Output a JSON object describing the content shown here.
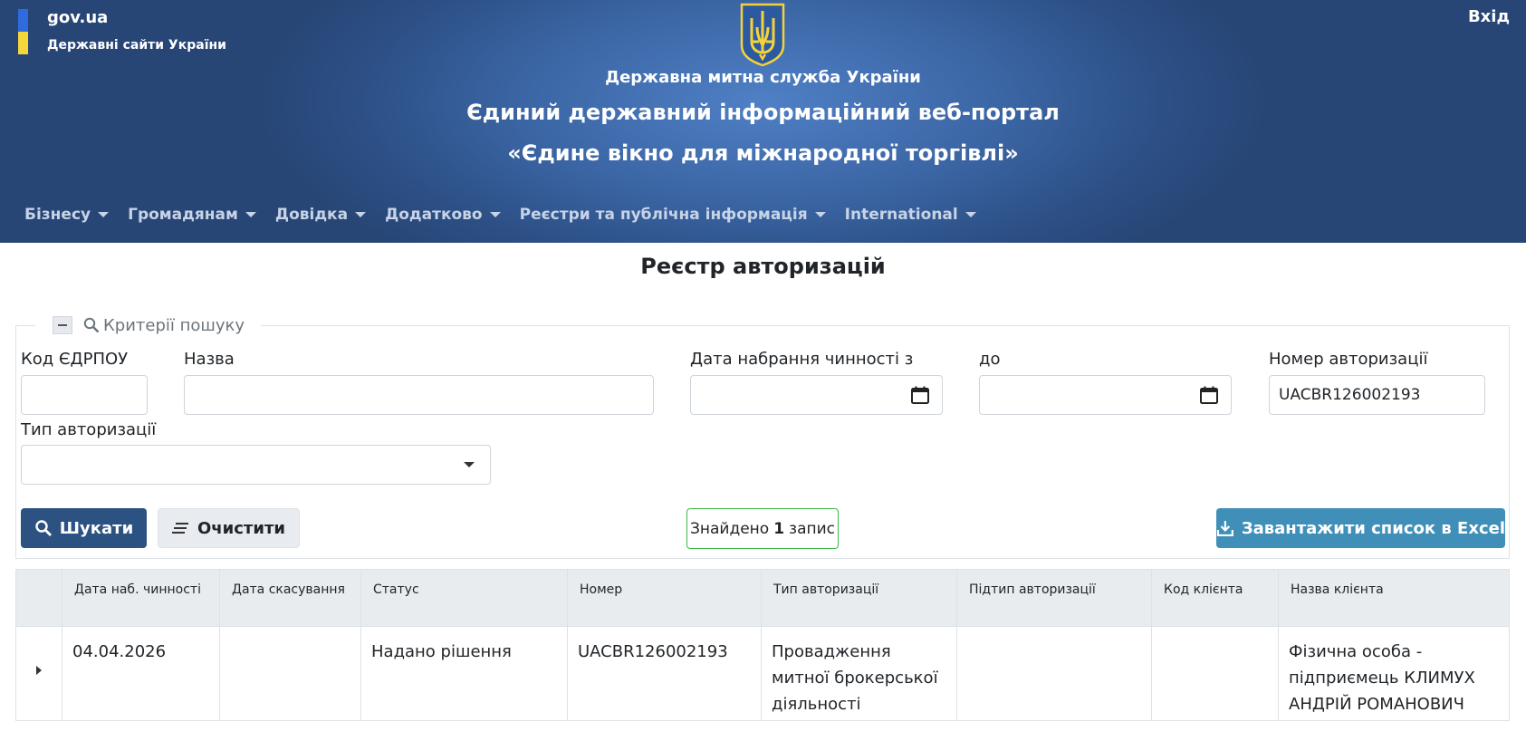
{
  "header": {
    "govua_title": "gov.ua",
    "govua_subtitle": "Державні сайти України",
    "login_label": "Вхід",
    "agency": "Державна митна служба України",
    "portal_line1": "Єдиний державний інформаційний веб-портал",
    "portal_line2": "«Єдине вікно для міжнародної торгівлі»",
    "flag_colors": [
      "#2f6bdc",
      "#f5d73c"
    ]
  },
  "nav": {
    "items": [
      {
        "label": "Бізнесу"
      },
      {
        "label": "Громадянам"
      },
      {
        "label": "Довідка"
      },
      {
        "label": "Додатково"
      },
      {
        "label": "Реєстри та публічна інформація"
      },
      {
        "label": "International"
      }
    ]
  },
  "page": {
    "title": "Реєстр авторизацій"
  },
  "criteria": {
    "legend": "Критерії пошуку",
    "fields": {
      "edrpou": {
        "label": "Код ЄДРПОУ",
        "value": ""
      },
      "name": {
        "label": "Назва",
        "value": ""
      },
      "date_from": {
        "label": "Дата набрання чинності з",
        "value": ""
      },
      "date_to": {
        "label": "до",
        "value": ""
      },
      "auth_number": {
        "label": "Номер авторизації",
        "value": "UACBR126002193"
      },
      "auth_type": {
        "label": "Тип авторизації",
        "value": ""
      }
    },
    "search_label": "Шукати",
    "clear_label": "Очистити",
    "found_prefix": "Знайдено",
    "found_count": "1",
    "found_suffix": "запис",
    "excel_label": "Завантажити список в Excel"
  },
  "table": {
    "columns": [
      "Дата наб. чинності",
      "Дата скасування",
      "Статус",
      "Номер",
      "Тип авторизації",
      "Підтип авторизації",
      "Код клієнта",
      "Назва клієнта"
    ],
    "rows": [
      {
        "effective_date": "04.04.2026",
        "cancel_date": "",
        "status": "Надано рішення",
        "number": "UACBR126002193",
        "type": "Провадження митної брокерської діяльності",
        "subtype": "",
        "client_code": "",
        "client_name": "Фізична особа - підприємець КЛИМУХ АНДРІЙ РОМАНОВИЧ"
      }
    ]
  },
  "colors": {
    "header_bg": "#3c67a6",
    "primary_button": "#2c5282",
    "excel_button": "#3f8fb8",
    "found_border": "#3fb84a"
  }
}
